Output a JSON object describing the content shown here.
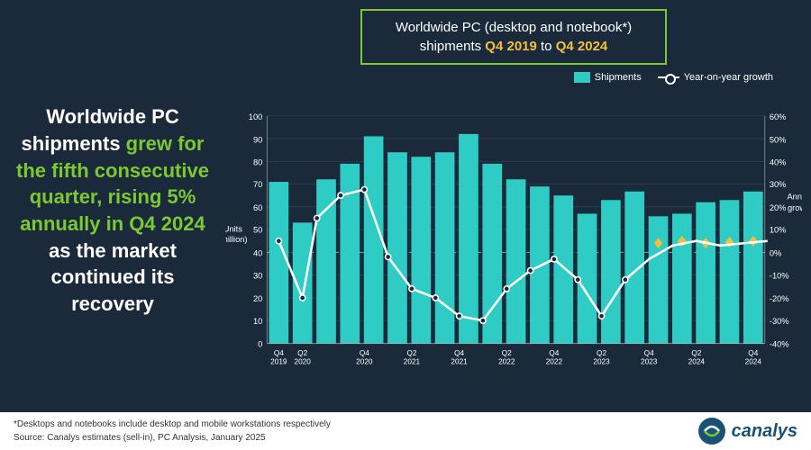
{
  "title": {
    "line1": "Worldwide PC (desktop and notebook*)",
    "line2_prefix": "shipments ",
    "line2_q1": "Q4 2019",
    "line2_mid": " to ",
    "line2_q2": "Q4 2024"
  },
  "left_text": {
    "part1": "Worldwide PC\nshipments ",
    "part2": "grew for\nthe fifth consecutive\nquarter, rising 5%\nannually in Q4 2024",
    "part3": "\nas the market\ncontinued its\nrecovery"
  },
  "legend": {
    "shipments_label": "Shipments",
    "growth_label": "Year-on-year growth"
  },
  "y_axis_left": {
    "label": "Units\n(million)",
    "ticks": [
      0,
      10,
      20,
      30,
      40,
      50,
      60,
      70,
      80,
      90,
      100
    ]
  },
  "y_axis_right": {
    "label": "Annual\ngrowth",
    "ticks": [
      "-40%",
      "-30%",
      "-20%",
      "-10%",
      "0%",
      "10%",
      "20%",
      "30%",
      "40%",
      "50%",
      "60%"
    ]
  },
  "x_axis": {
    "quarters": [
      "Q4\n2019",
      "Q2\n2020",
      "Q4\n2020",
      "Q2\n2021",
      "Q4\n2021",
      "Q2\n2022",
      "Q4\n2022",
      "Q2\n2023",
      "Q4\n2023",
      "Q2\n2024",
      "Q4\n2024"
    ]
  },
  "bars": [
    {
      "quarter": "Q4 2019",
      "value": 71
    },
    {
      "quarter": "Q1 2020",
      "value": 53
    },
    {
      "quarter": "Q2 2020",
      "value": 72
    },
    {
      "quarter": "Q3 2020",
      "value": 79
    },
    {
      "quarter": "Q4 2020",
      "value": 91
    },
    {
      "quarter": "Q1 2021",
      "value": 84
    },
    {
      "quarter": "Q2 2021",
      "value": 82
    },
    {
      "quarter": "Q3 2021",
      "value": 84
    },
    {
      "quarter": "Q4 2021",
      "value": 92
    },
    {
      "quarter": "Q1 2022",
      "value": 79
    },
    {
      "quarter": "Q2 2022",
      "value": 72
    },
    {
      "quarter": "Q3 2022",
      "value": 69
    },
    {
      "quarter": "Q4 2022",
      "value": 65
    },
    {
      "quarter": "Q1 2023",
      "value": 57
    },
    {
      "quarter": "Q2 2023",
      "value": 63
    },
    {
      "quarter": "Q3 2023",
      "value": 67
    },
    {
      "quarter": "Q4 2023",
      "value": 56
    },
    {
      "quarter": "Q1 2024",
      "value": 57
    },
    {
      "quarter": "Q2 2024",
      "value": 62
    },
    {
      "quarter": "Q3 2024",
      "value": 63
    },
    {
      "quarter": "Q4 2024",
      "value": 67
    }
  ],
  "growth_line": [
    5,
    -20,
    15,
    25,
    28,
    -2,
    -10,
    -16,
    -28,
    -30,
    -8,
    -3,
    -12,
    -28,
    -12,
    -3,
    3,
    5,
    3,
    4,
    5
  ],
  "footer": {
    "note": "*Desktops and notebooks include desktop and mobile workstations respectively",
    "source": "Source: Canalys estimates (sell-in), PC Analysis, January 2025",
    "logo_text": "canalys"
  },
  "colors": {
    "background": "#1a2a3a",
    "bar": "#2eccc4",
    "bar_estimate": "#2eccc4",
    "line": "#ffffff",
    "highlight_green": "#7dc832",
    "highlight_yellow": "#f0c040",
    "grid": "rgba(255,255,255,0.15)",
    "dashed": "rgba(255,255,255,0.4)"
  }
}
